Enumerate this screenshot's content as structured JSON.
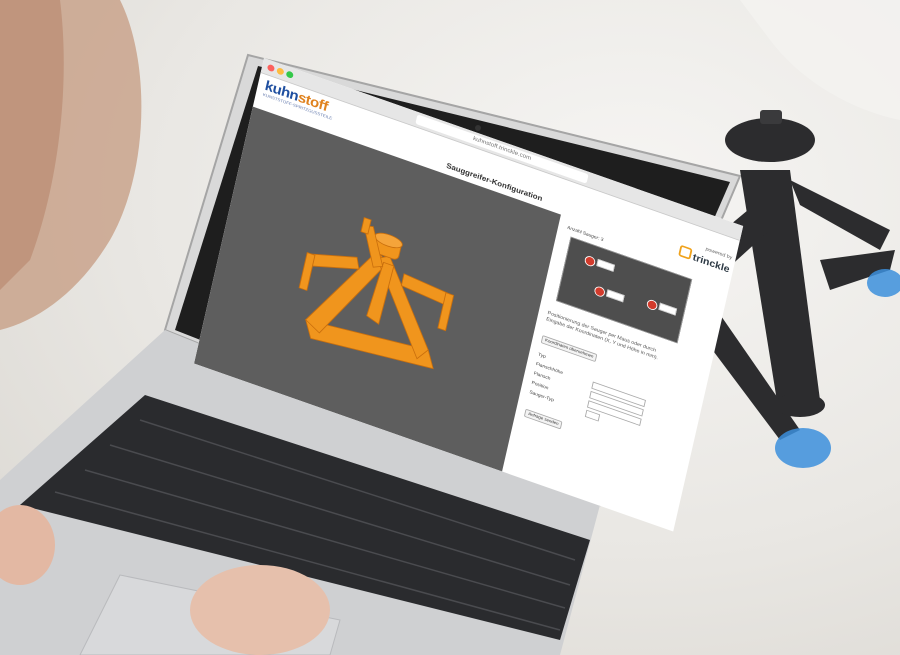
{
  "browser": {
    "url": "kuhnstoff.trinckle.com"
  },
  "brand": {
    "logo_part1": "kuhn",
    "logo_part2": "stoff",
    "tagline": "KUNSTSTOFF-SPRITZGUSSTEILE",
    "primary_color": "#1f4fa0",
    "accent_color": "#e0821e"
  },
  "page": {
    "title": "Sauggreifer-Konfiguration"
  },
  "powered_by": {
    "label": "powered by",
    "partner": "trinckle",
    "partner_color": "#f0a21b"
  },
  "panel": {
    "count_label": "Anzahl Sauger",
    "count_value": "3",
    "description": "Positionierung der Sauger per Maus oder durch Eingabe der Koordinaten (X, Y und Höhe in mm).",
    "apply_button": "Koordinaten übernehmen",
    "rows": [
      {
        "label": "Typ"
      },
      {
        "label": "Flanschhöhe"
      },
      {
        "label": "Flansch"
      },
      {
        "label": "Position"
      },
      {
        "label": "Sauger-Typ"
      }
    ],
    "submit_button": "Anfrage senden"
  },
  "model": {
    "color": "#f0951d"
  }
}
